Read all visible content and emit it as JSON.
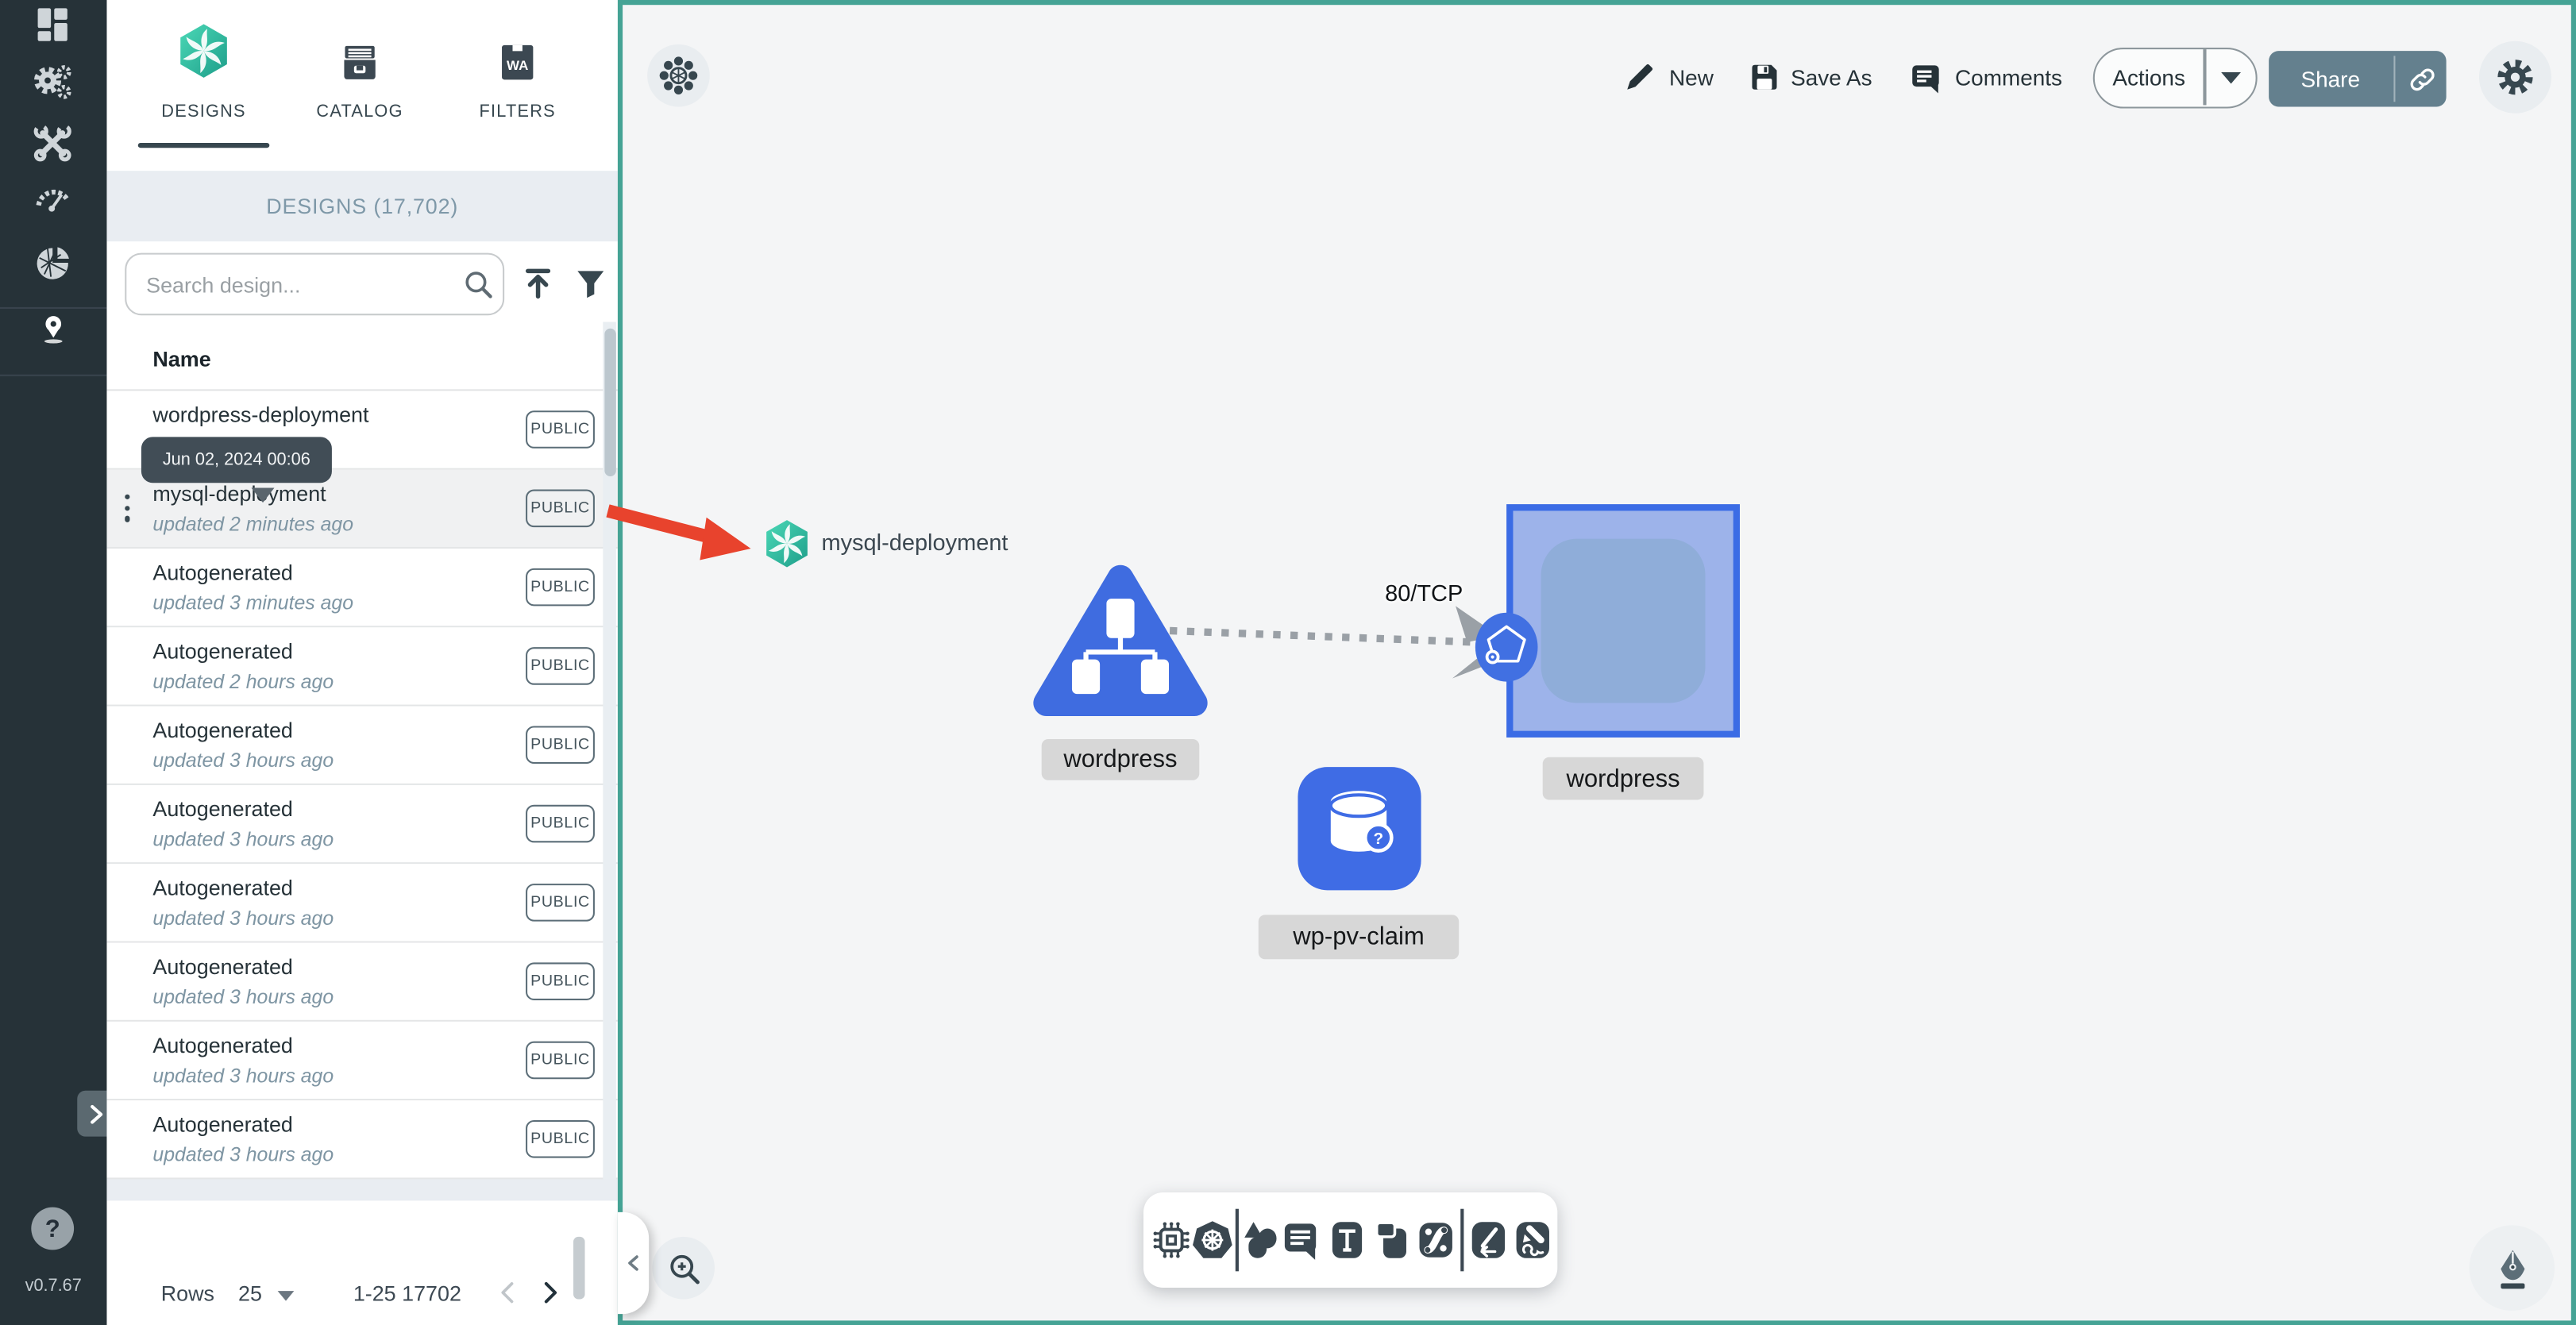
{
  "app": {
    "version": "v0.7.67",
    "help_label": "?"
  },
  "sidebar": {
    "icons": [
      "dashboard-icon",
      "lifecycle-gears-icon",
      "configuration-tools-icon",
      "performance-speedometer-icon",
      "extensions-icon",
      "kanvas-pin-icon"
    ]
  },
  "tabs": [
    {
      "label": "DESIGNS",
      "icon": "meshery-swirl-icon",
      "active": true
    },
    {
      "label": "CATALOG",
      "icon": "catalog-drawer-icon",
      "active": false
    },
    {
      "label": "FILTERS",
      "icon": "wasm-filter-icon",
      "icon_text": "WA",
      "active": false
    }
  ],
  "panel": {
    "header": "DESIGNS (17,702)",
    "search_placeholder": "Search design...",
    "column_name": "Name",
    "tooltip": "Jun 02, 2024 00:06",
    "rows": [
      {
        "name": "wordpress-deployment",
        "badge": "PUBLIC"
      },
      {
        "name": "mysql-deployment",
        "updated": "updated 2 minutes ago",
        "badge": "PUBLIC",
        "highlighted": true
      },
      {
        "name": "Autogenerated",
        "updated": "updated 3 minutes ago",
        "badge": "PUBLIC"
      },
      {
        "name": "Autogenerated",
        "updated": "updated 2 hours ago",
        "badge": "PUBLIC"
      },
      {
        "name": "Autogenerated",
        "updated": "updated 3 hours ago",
        "badge": "PUBLIC"
      },
      {
        "name": "Autogenerated",
        "updated": "updated 3 hours ago",
        "badge": "PUBLIC"
      },
      {
        "name": "Autogenerated",
        "updated": "updated 3 hours ago",
        "badge": "PUBLIC"
      },
      {
        "name": "Autogenerated",
        "updated": "updated 3 hours ago",
        "badge": "PUBLIC"
      },
      {
        "name": "Autogenerated",
        "updated": "updated 3 hours ago",
        "badge": "PUBLIC"
      },
      {
        "name": "Autogenerated",
        "updated": "updated 3 hours ago",
        "badge": "PUBLIC"
      }
    ],
    "pagination": {
      "rows_label": "Rows",
      "rows_per_page": "25",
      "range": "1-25 17702"
    }
  },
  "topbar": {
    "new_label": "New",
    "save_as_label": "Save As",
    "comments_label": "Comments",
    "actions_label": "Actions",
    "share_label": "Share"
  },
  "canvas": {
    "mysql_label": "mysql-deployment",
    "service_label": "wordpress",
    "deployment_label": "wordpress",
    "pvc_label": "wp-pv-claim",
    "pvc_badge": "?",
    "edge_label": "80/TCP"
  },
  "bottom_toolbar_icons": [
    "component-chip-icon",
    "kubernetes-icon",
    "shapes-icon",
    "note-icon",
    "text-tool-icon",
    "card-icon",
    "siphon-link-icon",
    "pen-arrow-icon",
    "doodle-icon"
  ],
  "colors": {
    "sidebar_bg": "#263238",
    "teal_border": "#45a395",
    "node_blue": "#3f6ce5",
    "selected_fill": "#9db3ea",
    "arrow_red": "#e8432d",
    "header_strip": "#e9edf2",
    "label_gray": "#d7d7d7"
  }
}
